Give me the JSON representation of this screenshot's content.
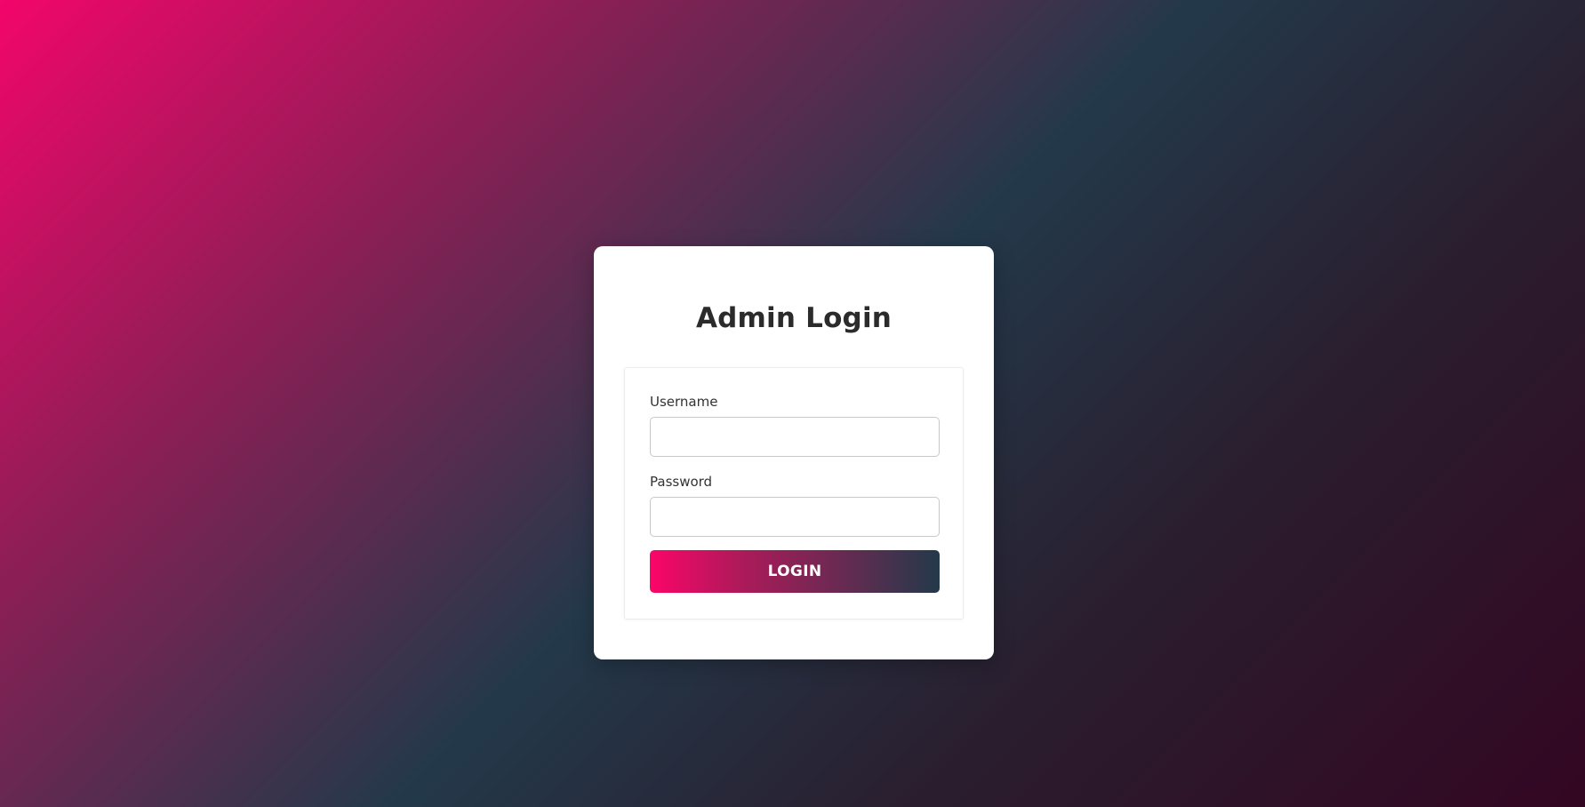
{
  "login": {
    "title": "Admin Login",
    "username_label": "Username",
    "username_value": "",
    "password_label": "Password",
    "password_value": "",
    "submit_label": "LOGIN"
  },
  "colors": {
    "accent_start": "#fb0569",
    "accent_end": "#23394a"
  }
}
